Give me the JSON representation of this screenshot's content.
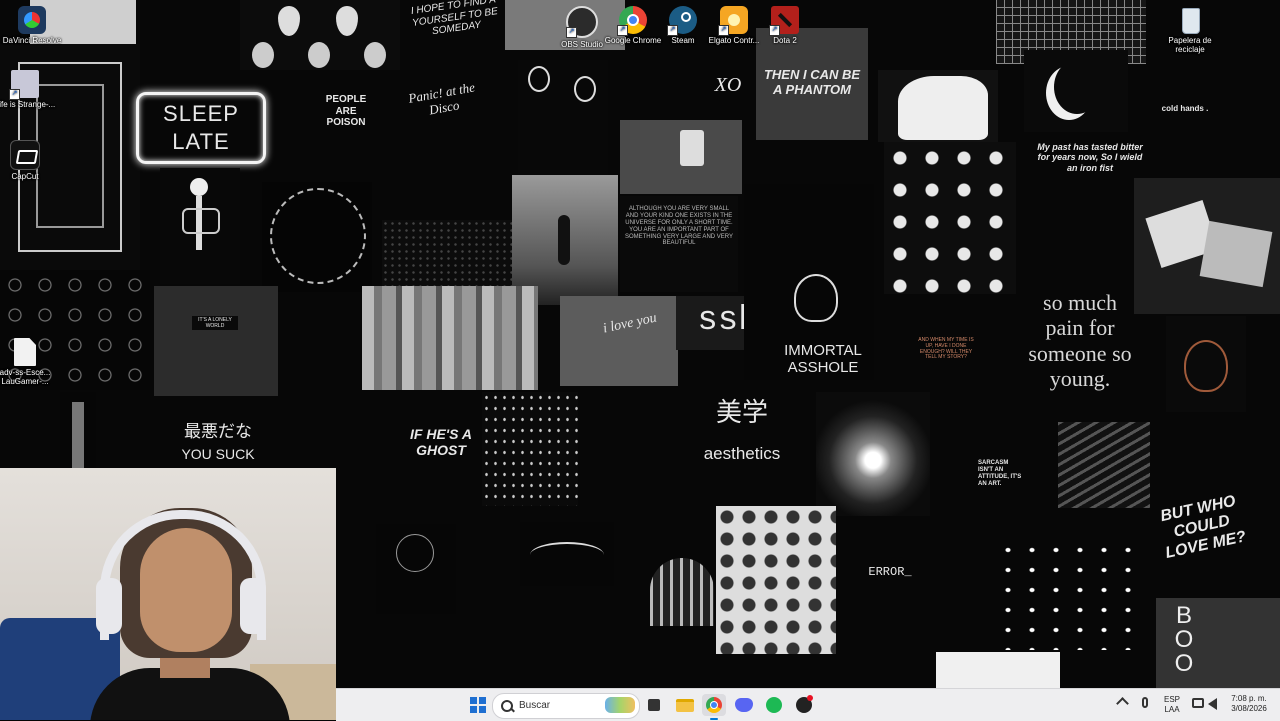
{
  "desktop": {
    "icons": [
      {
        "name": "DaVinci Resolve",
        "icon": "davinci-resolve-icon",
        "color": "#1e3a5f"
      },
      {
        "name": "Life is Strange-...",
        "icon": "game-shortcut-icon",
        "color": "#c8c8d8"
      },
      {
        "name": "CapCut",
        "icon": "capcut-icon",
        "color": "#111111"
      },
      {
        "name": "adv-ss-Esce... LauGamer-...",
        "icon": "document-icon",
        "color": "#f2f2f2"
      },
      {
        "name": "OBS Studio",
        "icon": "obs-icon",
        "color": "#2b2b2b"
      },
      {
        "name": "Google Chrome",
        "icon": "chrome-icon",
        "color": "#4285f4"
      },
      {
        "name": "Steam",
        "icon": "steam-icon",
        "color": "#1b5c85"
      },
      {
        "name": "Elgato Contr...",
        "icon": "elgato-icon",
        "color": "#f5a623"
      },
      {
        "name": "Dota 2",
        "icon": "dota2-icon",
        "color": "#b3201b"
      },
      {
        "name": "Papelera de reciclaje",
        "icon": "recycle-bin-icon",
        "color": "#dfe8ef"
      }
    ]
  },
  "wallpaper": {
    "sleep_late_1": "SLEEP",
    "sleep_late_2": "LATE",
    "people_poison": "PEOPLE ARE POISON",
    "panic": "Panic! at the Disco",
    "phantom": "THEN I CAN BE A PHANTOM",
    "hope": "I HOPE TO FIND A YOURSELF TO BE SOMEDAY",
    "cold_hands": "cold hands .",
    "past_tasted": "My past has tasted bitter for years now, So I wield an iron fist",
    "lonely": "IT'S A LONELY WORLD",
    "small_text": "ALTHOUGH YOU ARE VERY SMALL AND YOUR KIND ONE EXISTS IN THE UNIVERSE FOR ONLY A SHORT TIME. YOU ARE AN IMPORTANT PART OF SOMETHING VERY LARGE AND VERY BEAUTIFUL",
    "i_love_you": "i love you",
    "sssh": "ssh",
    "immortal": "IMMORTAL ASSHOLE",
    "story": "AND WHEN MY TIME IS UP, HAVE I DONE ENOUGH? WILL THEY TELL MY STORY?",
    "so_much_pain": "so much pain for someone so young.",
    "jp_bad": "最悪だな",
    "you_suck": "YOU SUCK",
    "if_ghost": "IF HE'S A GHOST",
    "bigaku": "美学",
    "aesthetics": "aesthetics",
    "sarcasm": "SARCASM ISN'T AN ATTITUDE, IT'S AN ART.",
    "who_love": "BUT WHO COULD LOVE ME?",
    "error": "ERROR_",
    "boo": "BOO",
    "xo": "XO"
  },
  "taskbar": {
    "search_placeholder": "Buscar",
    "lang_top": "ESP",
    "lang_bottom": "LAA",
    "time": "7:08 p. m.",
    "date": "3/08/2026",
    "accent": "#0078d4"
  }
}
